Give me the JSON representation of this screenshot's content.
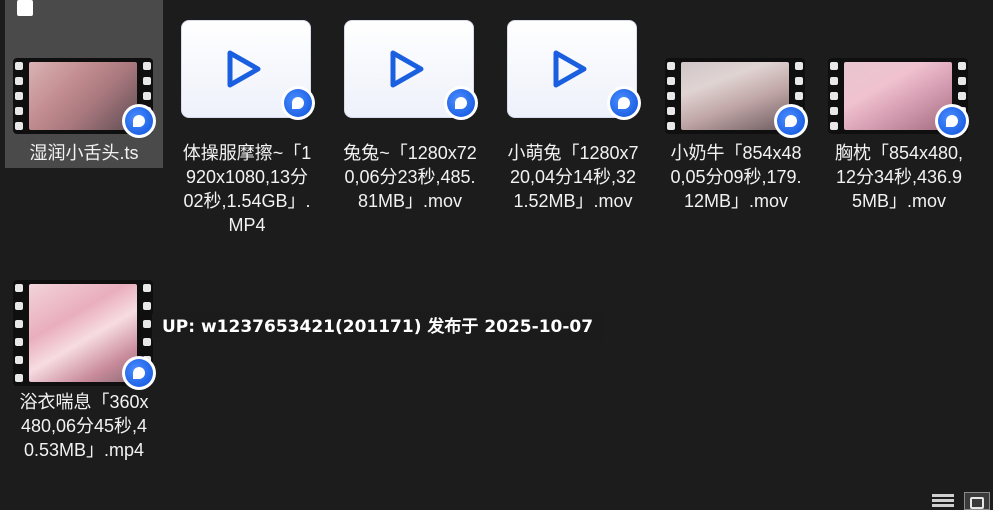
{
  "files": [
    {
      "name": "湿润小舌头.ts",
      "thumb": "film",
      "image": "img-a",
      "selected": true
    },
    {
      "name": "体操服摩擦~「1920x1080,13分02秒,1.54GB」.MP4",
      "thumb": "doc"
    },
    {
      "name": "兔兔~「1280x720,06分23秒,485.81MB」.mov",
      "thumb": "doc"
    },
    {
      "name": "小萌兔「1280x720,04分14秒,321.52MB」.mov",
      "thumb": "doc"
    },
    {
      "name": "小奶牛「854x480,05分09秒,179.12MB」.mov",
      "thumb": "film",
      "image": "img-b"
    },
    {
      "name": "胸枕「854x480,12分34秒,436.95MB」.mov",
      "thumb": "film",
      "image": "img-c"
    },
    {
      "name": "浴衣喘息「360x480,06分45秒,40.53MB」.mp4",
      "thumb": "film",
      "image": "img-d"
    }
  ],
  "tooltip": "UP: w1237653421(201171) 发布于 2025-10-07",
  "colors": {
    "background": "#1c1c1c",
    "selection": "#4a4a4a",
    "badge_blue": "#1f63e6",
    "play_blue": "#1a5fe0"
  },
  "icons": {
    "play": "play-icon",
    "badge": "player-app-badge-icon",
    "details_view": "details-view-icon",
    "large_icons_view": "large-icons-view-icon"
  }
}
